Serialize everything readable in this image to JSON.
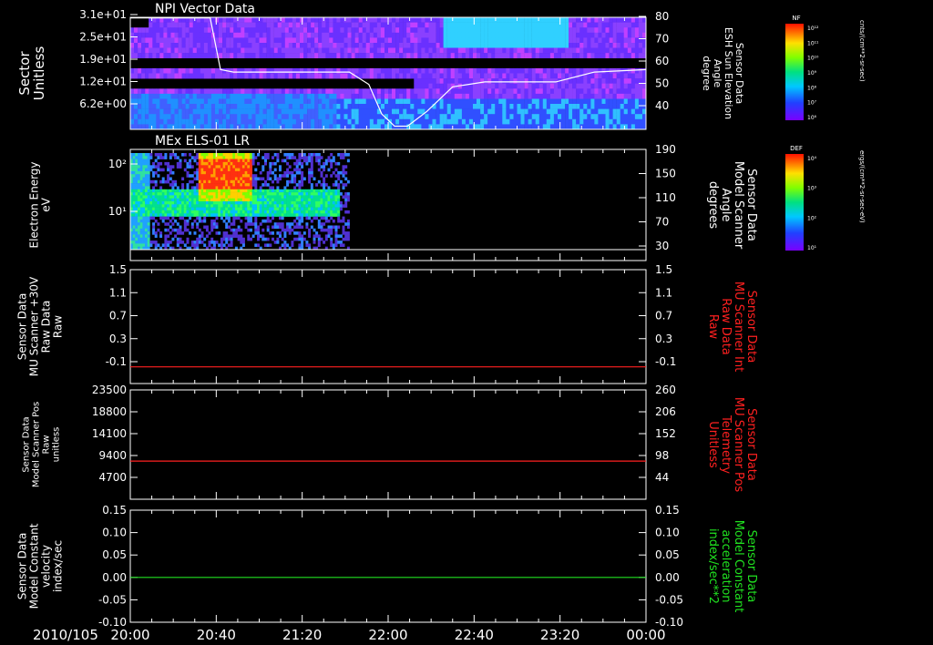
{
  "colors": {
    "background": "#000000",
    "axis": "#ffffff",
    "red_trace": "#ff2020",
    "green_trace": "#20e020"
  },
  "time_axis": {
    "date_label": "2010/105",
    "ticks": [
      "20:00",
      "20:40",
      "21:20",
      "22:00",
      "22:40",
      "23:20",
      "00:00"
    ],
    "range_hours": [
      20,
      24
    ]
  },
  "colorbars": [
    {
      "label": "NF",
      "unit": "cnts/(cm**2-sr-sec)",
      "ticks": [
        "10¹²",
        "10¹¹",
        "10¹⁰",
        "10⁹",
        "10⁸",
        "10⁷",
        "10⁶"
      ]
    },
    {
      "label": "DEF",
      "unit": "ergs/(cm**2-sr-sec-eV)",
      "ticks": [
        "10⁴",
        "10³",
        "10²",
        "10¹"
      ]
    }
  ],
  "chart_data": [
    {
      "type": "heatmap",
      "title": "NPI Vector Data",
      "ylabel": [
        "Sector",
        "Unitless"
      ],
      "y_ticks": [
        "3.1e+01",
        "2.5e+01",
        "1.9e+01",
        "1.2e+01",
        "6.2e+00"
      ],
      "y2label": [
        "Sensor Data",
        "ESH Sun Elevation",
        "Angle",
        "degree"
      ],
      "y2_ticks": [
        "80",
        "70",
        "60",
        "50",
        "40"
      ],
      "y2_range": [
        30,
        80
      ],
      "overlay_line": {
        "name": "ESH Sun Elevation Angle",
        "x_hours": [
          20.0,
          20.62,
          20.7,
          20.8,
          21.3,
          21.7,
          21.85,
          21.95,
          22.05,
          22.15,
          22.3,
          22.5,
          22.75,
          23.0,
          23.3,
          23.6,
          24.0
        ],
        "y_degrees": [
          79,
          79,
          58,
          57,
          57,
          57,
          52,
          40,
          35,
          35,
          41,
          51,
          53,
          53,
          53,
          57,
          58
        ]
      }
    },
    {
      "type": "heatmap",
      "title": "MEx ELS-01 LR",
      "ylabel": [
        "Electron Energy",
        "eV"
      ],
      "y_ticks": [
        "10²",
        "10¹"
      ],
      "y2label": [
        "Sensor Data",
        "Model Scanner",
        "Angle",
        "degrees"
      ],
      "y2_ticks": [
        "190",
        "150",
        "110",
        "70",
        "30"
      ],
      "data_extent_hours": [
        20.0,
        21.7
      ]
    },
    {
      "type": "line",
      "ylabel": [
        "Sensor Data",
        "MU Scanner +30V",
        "Raw Data",
        "Raw"
      ],
      "y_ticks": [
        "1.5",
        "1.1",
        "0.7",
        "0.3",
        "-0.1"
      ],
      "ylim": [
        -0.3,
        1.5
      ],
      "y2label": [
        "Sensor Data",
        "MU Scanner Int",
        "Raw Data",
        "Raw"
      ],
      "y2_ticks": [
        "1.5",
        "1.1",
        "0.7",
        "0.3",
        "-0.1"
      ],
      "series": [
        {
          "values": [
            0.0,
            0.0
          ]
        }
      ],
      "x_hours": [
        20.0,
        24.0
      ]
    },
    {
      "type": "line",
      "ylabel": [
        "Sensor Data",
        "Model Scanner Pos",
        "Raw",
        "unitless"
      ],
      "y_ticks": [
        "23500",
        "18800",
        "14100",
        "9400",
        "4700"
      ],
      "ylim": [
        0,
        23500
      ],
      "y2label": [
        "Sensor Data",
        "MU Scanner Pos",
        "Telemetry",
        "Unitless"
      ],
      "y2_ticks": [
        "260",
        "206",
        "152",
        "98",
        "44"
      ],
      "series": [
        {
          "values": [
            8200,
            8200
          ]
        }
      ],
      "x_hours": [
        20.0,
        24.0
      ]
    },
    {
      "type": "line",
      "ylabel": [
        "Sensor Data",
        "Model Constant",
        "velocity",
        "index/sec"
      ],
      "y_ticks": [
        "0.15",
        "0.10",
        "0.05",
        "0.00",
        "-0.05",
        "-0.10"
      ],
      "ylim": [
        -0.1,
        0.15
      ],
      "y2label": [
        "Sensor Data",
        "Model Constant",
        "acceleration",
        "index/sec**2"
      ],
      "y2_ticks": [
        "0.15",
        "0.10",
        "0.05",
        "0.00",
        "-0.05",
        "-0.10"
      ],
      "series": [
        {
          "values": [
            0.0,
            0.0
          ]
        }
      ],
      "x_hours": [
        20.0,
        24.0
      ]
    }
  ]
}
